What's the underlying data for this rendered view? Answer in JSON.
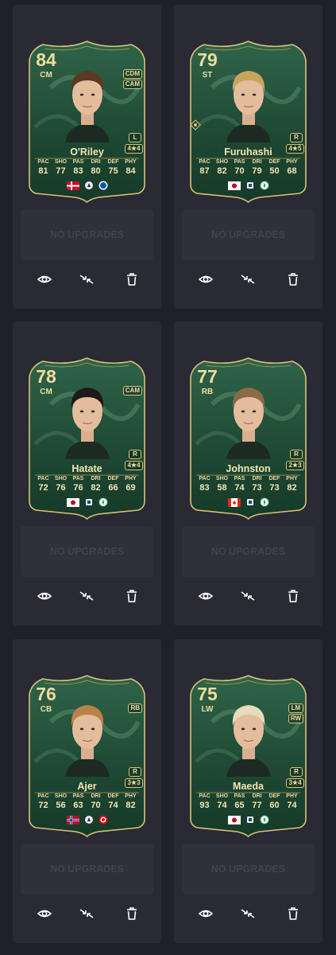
{
  "upgrade_label": "NO UPGRADES",
  "colors": {
    "page_bg": "#202128",
    "tile_bg": "#292a33",
    "card_green": "#1f4a34",
    "card_gold": "#d9c27a"
  },
  "stat_labels": [
    "PAC",
    "SHO",
    "PAS",
    "DRI",
    "DEF",
    "PHY"
  ],
  "actions": [
    "eye-icon",
    "swap-icon",
    "trash-icon"
  ],
  "players": [
    {
      "name": "O'Riley",
      "rating": "84",
      "position": "CM",
      "alt_positions": [
        "CDM",
        "CAM"
      ],
      "foot": "L",
      "skill_weak": "4★4",
      "stats": [
        "81",
        "77",
        "83",
        "80",
        "75",
        "84"
      ],
      "nation": "denmark-flag",
      "league": "premier-league-logo",
      "club": "brighton-badge",
      "hair": "#5a3a22",
      "chemistry_icon": false
    },
    {
      "name": "Furuhashi",
      "rating": "79",
      "position": "ST",
      "alt_positions": [],
      "foot": "R",
      "skill_weak": "4★5",
      "stats": [
        "87",
        "82",
        "70",
        "79",
        "50",
        "68"
      ],
      "nation": "japan-flag",
      "league": "spfl-logo",
      "club": "celtic-badge",
      "hair": "#c9a35b",
      "chemistry_icon": true
    },
    {
      "name": "Hatate",
      "rating": "78",
      "position": "CM",
      "alt_positions": [
        "CAM"
      ],
      "foot": "R",
      "skill_weak": "4★4",
      "stats": [
        "72",
        "76",
        "76",
        "82",
        "66",
        "69"
      ],
      "nation": "japan-flag",
      "league": "spfl-logo",
      "club": "celtic-badge",
      "hair": "#1e1a17",
      "chemistry_icon": false
    },
    {
      "name": "Johnston",
      "rating": "77",
      "position": "RB",
      "alt_positions": [],
      "foot": "R",
      "skill_weak": "2★3",
      "stats": [
        "83",
        "58",
        "74",
        "73",
        "73",
        "82"
      ],
      "nation": "canada-flag",
      "league": "spfl-logo",
      "club": "celtic-badge",
      "hair": "#8c6a48",
      "chemistry_icon": false
    },
    {
      "name": "Ajer",
      "rating": "76",
      "position": "CB",
      "alt_positions": [
        "RB"
      ],
      "foot": "R",
      "skill_weak": "3★3",
      "stats": [
        "72",
        "56",
        "63",
        "70",
        "74",
        "82"
      ],
      "nation": "norway-flag",
      "league": "premier-league-logo",
      "club": "brentford-badge",
      "hair": "#b9824a",
      "chemistry_icon": false
    },
    {
      "name": "Maeda",
      "rating": "75",
      "position": "LW",
      "alt_positions": [
        "LM",
        "RW"
      ],
      "foot": "R",
      "skill_weak": "3★4",
      "stats": [
        "93",
        "74",
        "65",
        "77",
        "60",
        "74"
      ],
      "nation": "japan-flag",
      "league": "spfl-logo",
      "club": "celtic-badge",
      "hair": "#e6dcbc",
      "chemistry_icon": false
    }
  ]
}
